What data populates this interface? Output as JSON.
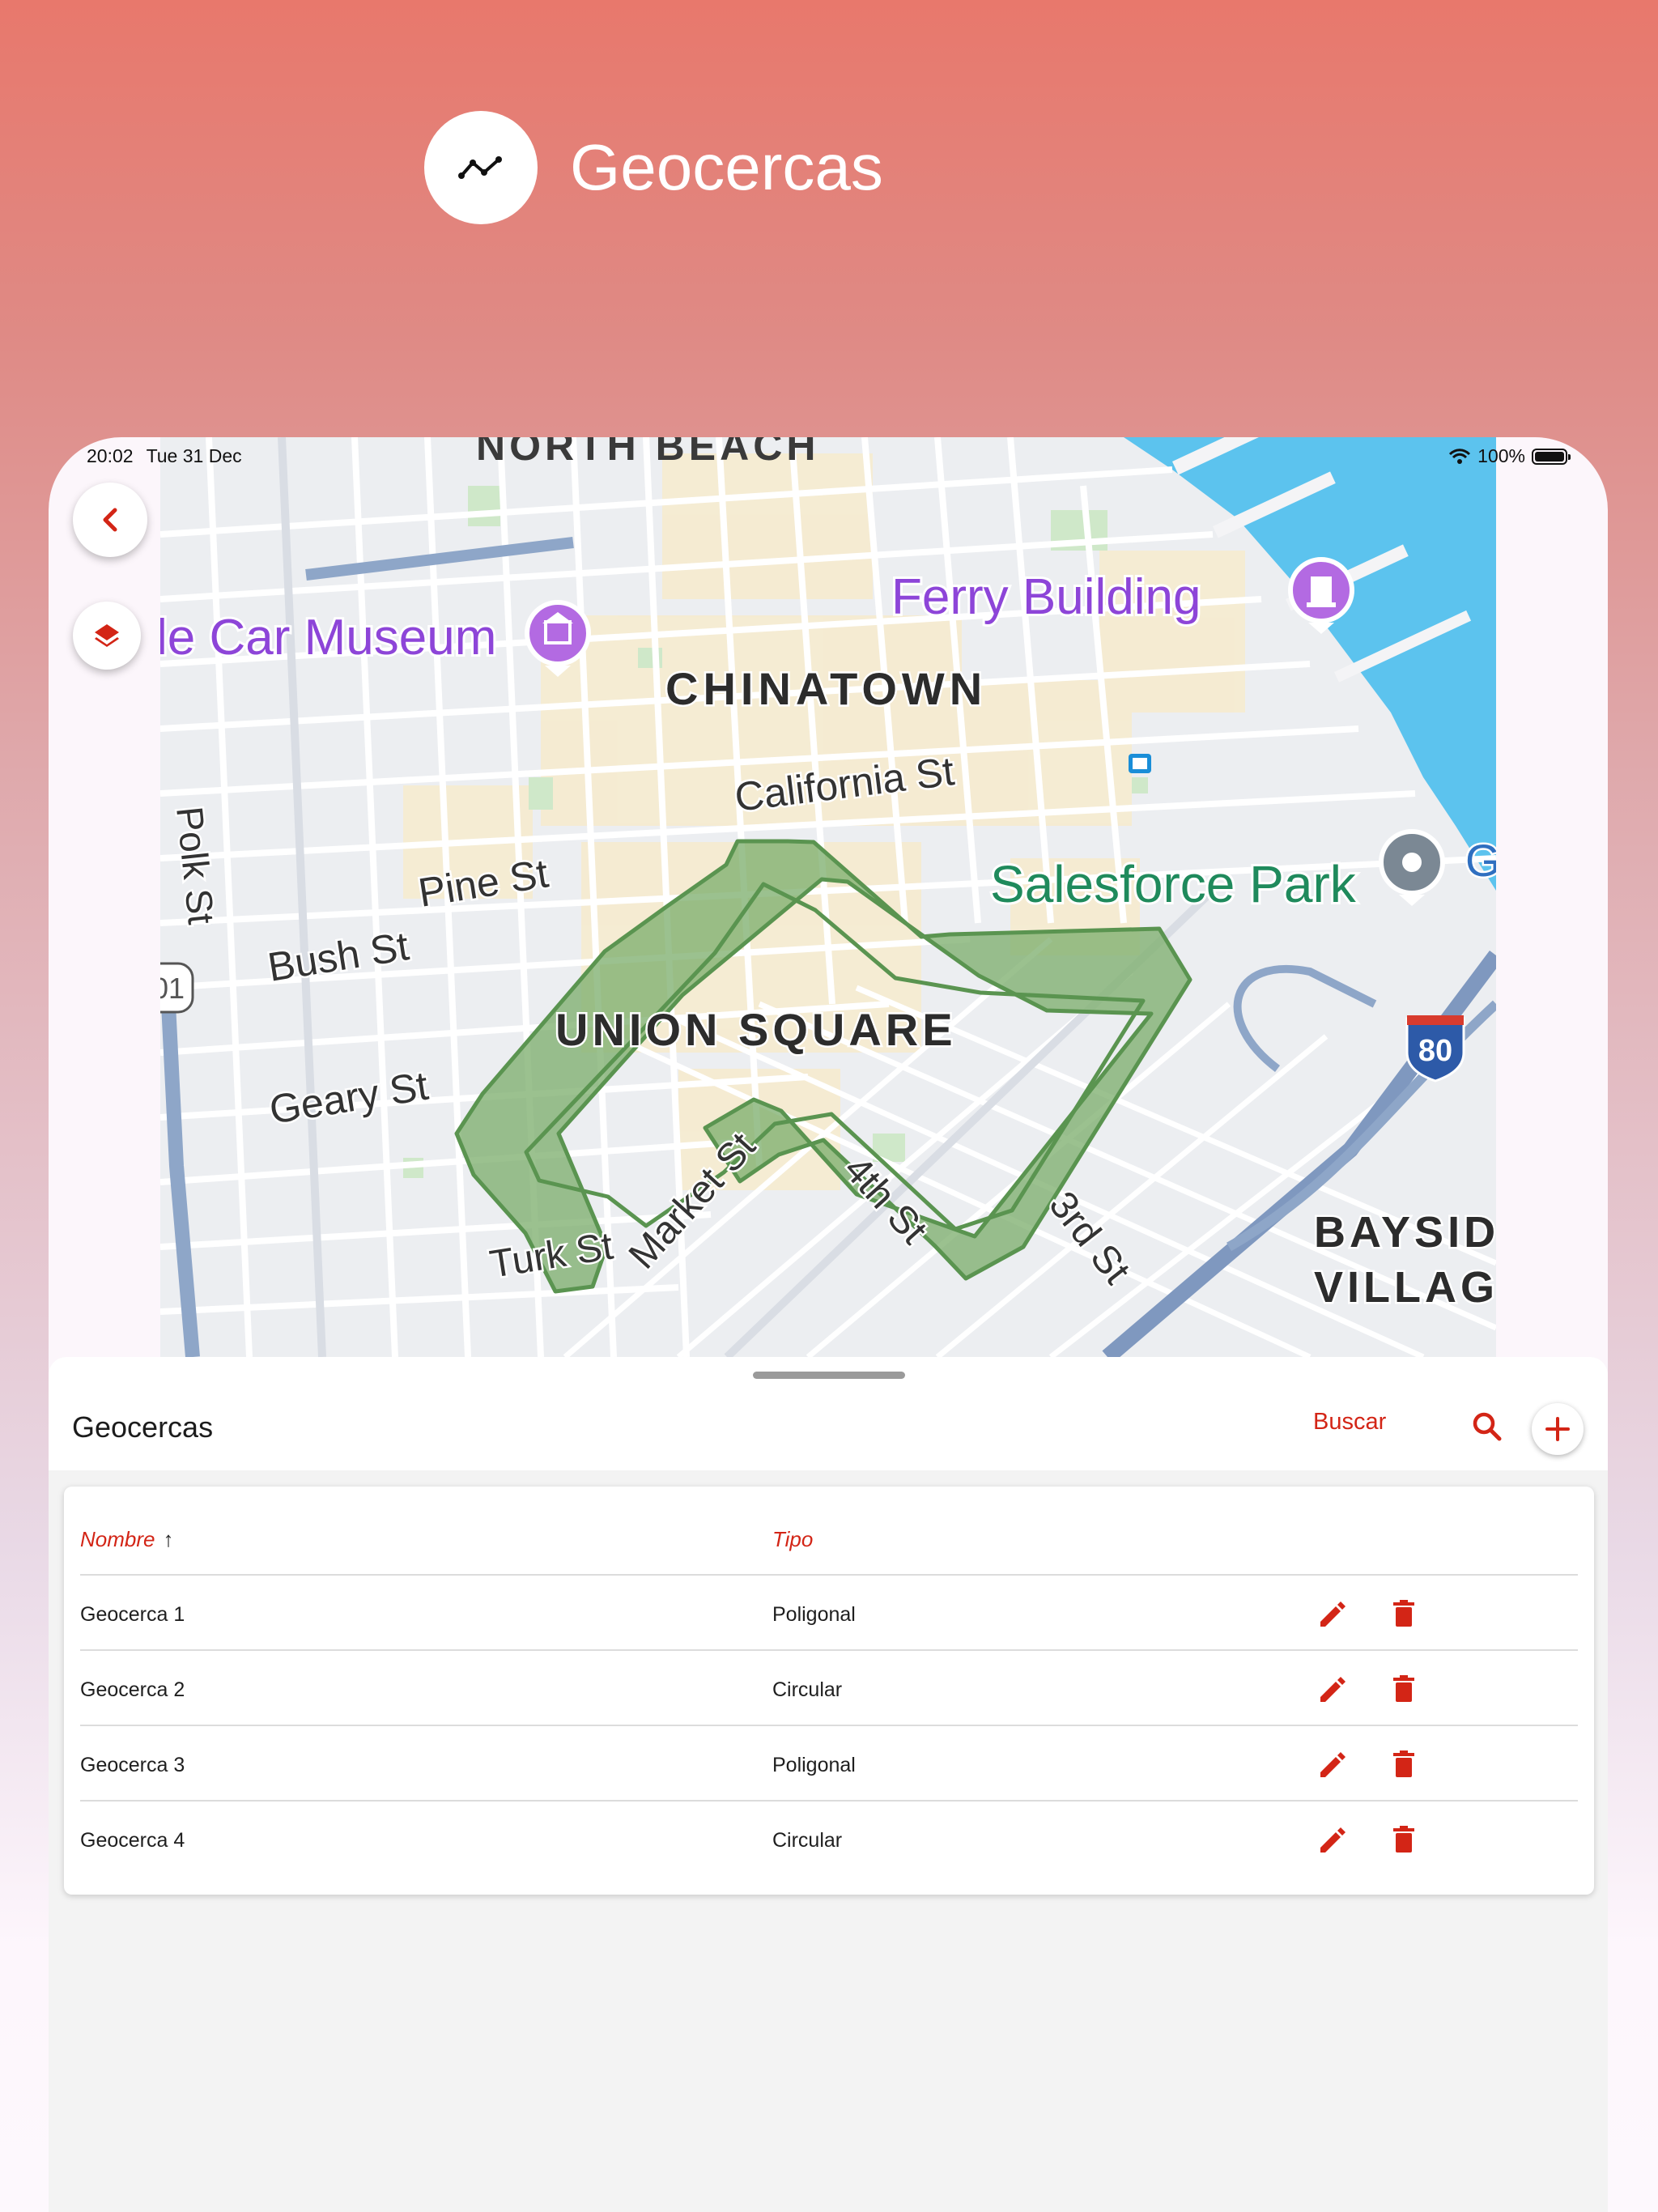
{
  "header": {
    "title": "Geocercas",
    "logo_icon": "trend-line-icon"
  },
  "status_bar": {
    "time": "20:02",
    "date": "Tue 31 Dec",
    "battery": "100%"
  },
  "map": {
    "labels": {
      "north_beach": "NORTH BEACH",
      "car_museum": "le Car Museum",
      "ferry_building": "Ferry Building",
      "chinatown": "CHINATOWN",
      "california_st": "California St",
      "polk_st": "Polk St",
      "pine_st": "Pine St",
      "bush_st": "Bush St",
      "salesforce_park": "Salesforce Park",
      "union_square": "UNION SQUARE",
      "geary_st": "Geary St",
      "turk_st": "Turk St",
      "market_st": "Market St",
      "fourth_st": "4th St",
      "third_st": "3rd St",
      "bayside": "BAYSID",
      "village": "VILLAG",
      "route_80": "80",
      "route_101": "01",
      "edge_g": "G"
    },
    "colors": {
      "geofence_fill": "#7fb070",
      "geofence_stroke": "#5a9450",
      "water": "#5cc3ee",
      "poi_purple": "#b36ae2"
    }
  },
  "sheet": {
    "title": "Geocercas",
    "search_label": "Buscar",
    "columns": {
      "name": "Nombre",
      "type": "Tipo"
    },
    "rows": [
      {
        "name": "Geocerca 1",
        "type": "Poligonal"
      },
      {
        "name": "Geocerca 2",
        "type": "Circular"
      },
      {
        "name": "Geocerca 3",
        "type": "Poligonal"
      },
      {
        "name": "Geocerca 4",
        "type": "Circular"
      }
    ],
    "accent_color": "#d32516"
  }
}
